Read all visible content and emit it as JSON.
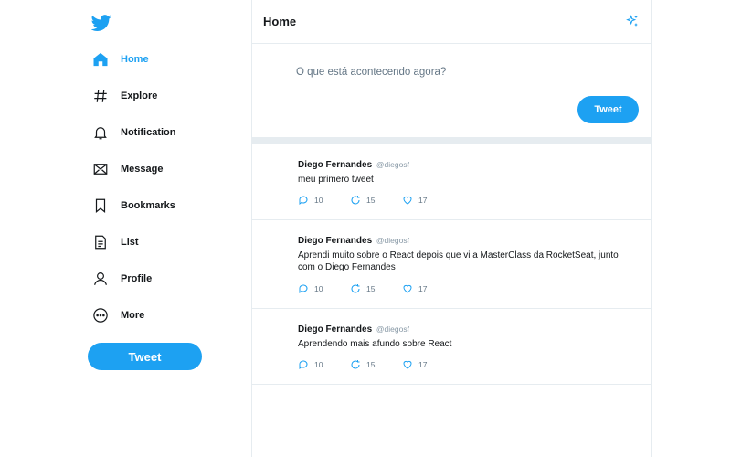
{
  "colors": {
    "brand": "#1da1f2",
    "text": "#14171a",
    "muted": "#657786",
    "border": "#e6ecf0"
  },
  "sidebar": {
    "logo_icon": "twitter-bird-icon",
    "items": [
      {
        "label": "Home",
        "icon": "home-icon",
        "active": true
      },
      {
        "label": "Explore",
        "icon": "hashtag-icon"
      },
      {
        "label": "Notification",
        "icon": "bell-icon"
      },
      {
        "label": "Message",
        "icon": "envelope-icon"
      },
      {
        "label": "Bookmarks",
        "icon": "bookmark-icon"
      },
      {
        "label": "List",
        "icon": "list-document-icon"
      },
      {
        "label": "Profile",
        "icon": "person-icon"
      },
      {
        "label": "More",
        "icon": "more-circle-icon"
      }
    ],
    "tweet_button": "Tweet"
  },
  "header": {
    "title": "Home",
    "icon": "sparkle-icon"
  },
  "composer": {
    "placeholder": "O que está acontecendo agora?",
    "button": "Tweet"
  },
  "tweets": [
    {
      "name": "Diego Fernandes",
      "handle": "@diegosf",
      "text": "meu primero tweet",
      "replies": "10",
      "retweets": "15",
      "likes": "17"
    },
    {
      "name": "Diego Fernandes",
      "handle": "@diegosf",
      "text": "Aprendi muito sobre o React depois que vi a MasterClass da RocketSeat, junto com o Diego Fernandes",
      "replies": "10",
      "retweets": "15",
      "likes": "17"
    },
    {
      "name": "Diego Fernandes",
      "handle": "@diegosf",
      "text": "Aprendendo mais afundo sobre React",
      "replies": "10",
      "retweets": "15",
      "likes": "17"
    }
  ]
}
